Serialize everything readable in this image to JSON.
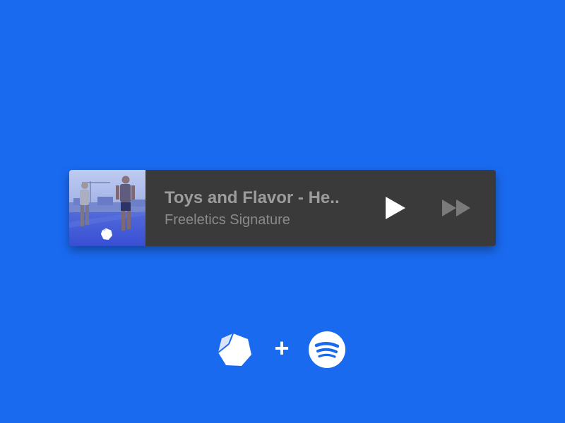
{
  "player": {
    "track_title": "Toys and Flavor - He..",
    "artist": "Freeletics Signature",
    "artwork_icon": "freeletics-logo-icon",
    "play_icon": "play-icon",
    "next_icon": "fast-forward-icon"
  },
  "integration": {
    "left_logo": "freeletics-logo-icon",
    "plus": "+",
    "right_logo": "spotify-logo-icon"
  },
  "colors": {
    "background": "#1a6af0",
    "player_background": "#3a3a3a",
    "title_text": "#9c9c9c",
    "artist_text": "#8a8a8a",
    "play_icon": "#ffffff",
    "next_icon": "#7a7a7a"
  }
}
